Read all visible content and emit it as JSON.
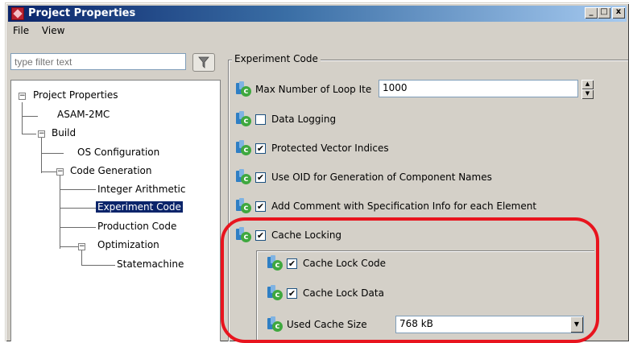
{
  "window": {
    "title": "Project Properties",
    "buttons": {
      "minimize": "_",
      "maximize": "□",
      "close": "x"
    }
  },
  "menu": [
    "File",
    "View"
  ],
  "filter": {
    "placeholder": "type filter text"
  },
  "tree": {
    "root": "Project Properties",
    "asam": "ASAM-2MC",
    "build": "Build",
    "os_config": "OS Configuration",
    "code_generation": "Code Generation",
    "integer_arithmetic": "Integer Arithmetic",
    "experiment_code": "Experiment Code",
    "production_code": "Production Code",
    "optimization": "Optimization",
    "statemachine": "Statemachine",
    "expander_symbol": "−"
  },
  "panel": {
    "group_title": "Experiment Code",
    "max_loop_label": "Max Number of Loop Ite",
    "max_loop_value": "1000",
    "data_logging": {
      "label": "Data Logging",
      "checked": false
    },
    "protected_vector": {
      "label": "Protected Vector Indices",
      "checked": true
    },
    "use_oid": {
      "label": "Use OID for Generation of Component Names",
      "checked": true
    },
    "add_comment": {
      "label": "Add Comment with Specification Info for each Element",
      "checked": true
    },
    "cache_locking": {
      "label": "Cache Locking",
      "checked": true
    },
    "cache_lock_code": {
      "label": "Cache Lock Code",
      "checked": true
    },
    "cache_lock_data": {
      "label": "Cache Lock Data",
      "checked": true
    },
    "used_cache_size_label": "Used Cache Size",
    "used_cache_size_value": "768 kB",
    "check_mark": "✔",
    "property_icon_letter": "c"
  },
  "colors": {
    "highlight": "#e8141e",
    "selection": "#0a246a"
  }
}
